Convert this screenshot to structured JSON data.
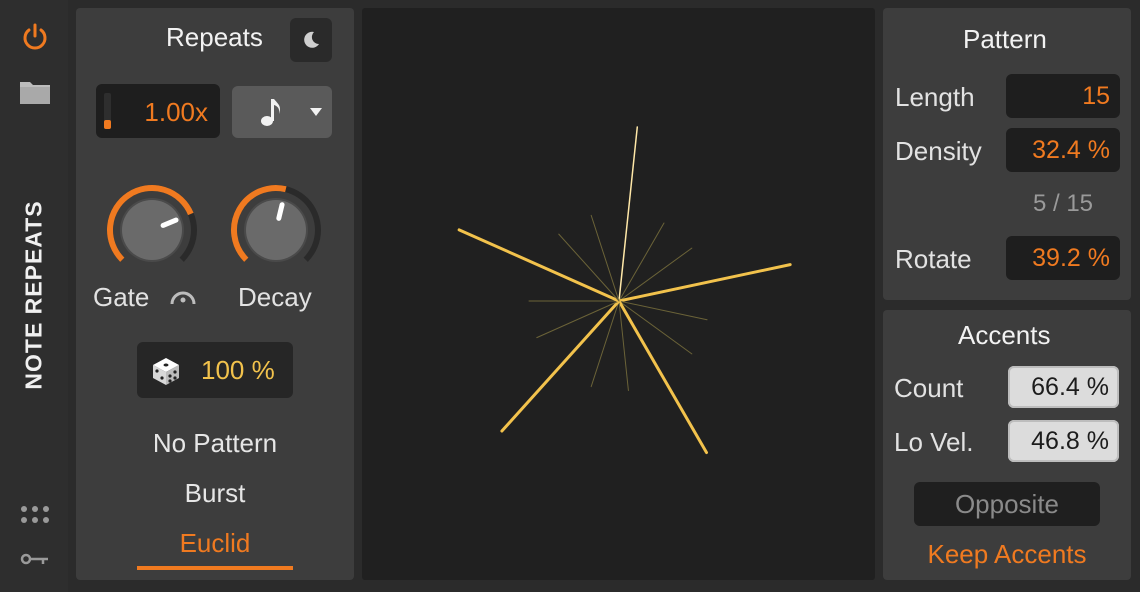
{
  "rail": {
    "title": "NOTE REPEATS"
  },
  "repeats": {
    "title": "Repeats",
    "rate_value": "1.00x",
    "rate_level": 0.25,
    "gate_label": "Gate",
    "gate_level": 0.75,
    "decay_label": "Decay",
    "decay_level": 0.55,
    "chance_value": "100 %",
    "modes": [
      "No Pattern",
      "Burst",
      "Euclid"
    ],
    "selected_mode": "Euclid"
  },
  "pattern": {
    "title": "Pattern",
    "length_label": "Length",
    "length_value": "15",
    "density_label": "Density",
    "density_value": "32.4 %",
    "ratio_text": "5 / 15",
    "rotate_label": "Rotate",
    "rotate_value": "39.2 %"
  },
  "accents": {
    "title": "Accents",
    "count_label": "Count",
    "count_value": "66.4 %",
    "lovel_label": "Lo Vel.",
    "lovel_value": "46.8 %",
    "opposite_label": "Opposite",
    "keep_label": "Keep Accents"
  },
  "display": {
    "steps": 15,
    "active_steps": [
      0,
      3,
      6,
      9,
      12
    ],
    "accent_color": "#f2c24c",
    "inactive_color": "#6b6338",
    "step0_color": "#ffe8a8"
  },
  "colors": {
    "accent": "#f07a20",
    "text": "#e6e6e6"
  }
}
